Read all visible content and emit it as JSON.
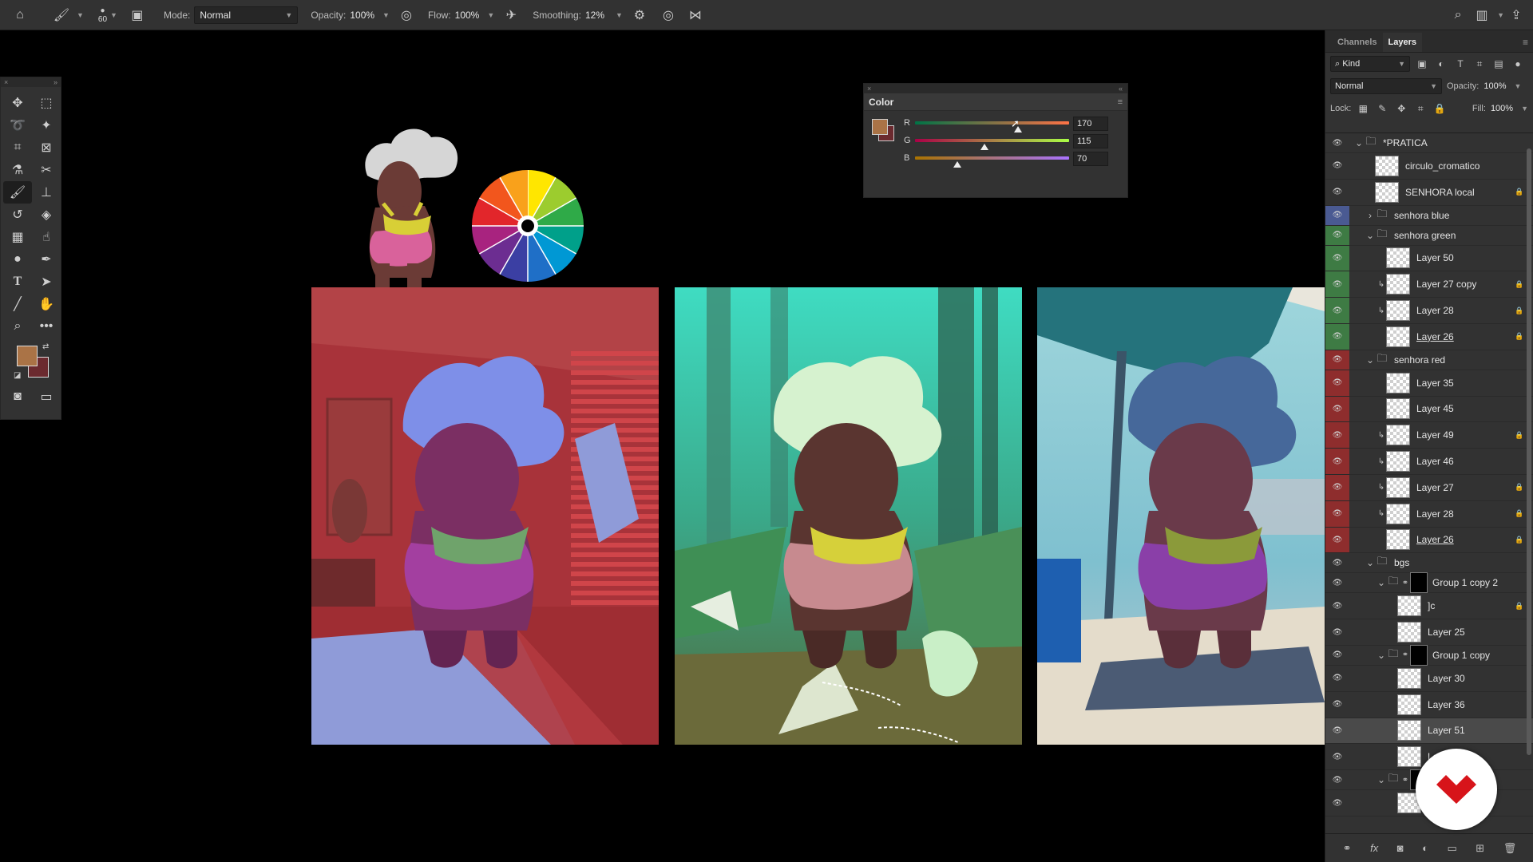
{
  "optbar": {
    "brush_size": "60",
    "mode_label": "Mode:",
    "mode_value": "Normal",
    "opacity_label": "Opacity:",
    "opacity_value": "100%",
    "flow_label": "Flow:",
    "flow_value": "100%",
    "smoothing_label": "Smoothing:",
    "smoothing_value": "12%"
  },
  "colors": {
    "foreground": "#aa7346",
    "background": "#6b2a2f",
    "accent_blue": "#4a5a92",
    "accent_green": "#3e7b44",
    "accent_red": "#8e2d2d"
  },
  "color_panel": {
    "title": "Color",
    "r_label": "R",
    "g_label": "G",
    "b_label": "B",
    "r_value": "170",
    "g_value": "115",
    "b_value": "70",
    "r_level": 0.667,
    "g_level": 0.451,
    "b_level": 0.275
  },
  "layers_panel": {
    "tab_channels": "Channels",
    "tab_layers": "Layers",
    "filter_kind": "Kind",
    "blend_mode": "Normal",
    "opacity_label": "Opacity:",
    "opacity_value": "100%",
    "lock_label": "Lock:",
    "fill_label": "Fill:",
    "fill_value": "100%",
    "layers": [
      {
        "name": "*PRATICA",
        "kind": "group",
        "indent": 0,
        "color": "",
        "open": true
      },
      {
        "name": "circulo_cromatico",
        "kind": "layer",
        "indent": 1,
        "color": "",
        "lock": false,
        "clip": false,
        "ul": false
      },
      {
        "name": "SENHORA local",
        "kind": "layer",
        "indent": 1,
        "color": "",
        "lock": true,
        "clip": false,
        "ul": false
      },
      {
        "name": "senhora blue",
        "kind": "group",
        "indent": 1,
        "color": "blue",
        "open": false
      },
      {
        "name": "senhora green",
        "kind": "group",
        "indent": 1,
        "color": "green",
        "open": true
      },
      {
        "name": "Layer 50",
        "kind": "layer",
        "indent": 2,
        "color": "green",
        "lock": false,
        "clip": false,
        "ul": false
      },
      {
        "name": "Layer 27 copy",
        "kind": "layer",
        "indent": 2,
        "color": "green",
        "lock": true,
        "clip": true,
        "ul": false
      },
      {
        "name": "Layer 28",
        "kind": "layer",
        "indent": 2,
        "color": "green",
        "lock": true,
        "clip": true,
        "ul": false
      },
      {
        "name": "Layer 26",
        "kind": "layer",
        "indent": 2,
        "color": "green",
        "lock": true,
        "clip": false,
        "ul": true
      },
      {
        "name": "senhora red",
        "kind": "group",
        "indent": 1,
        "color": "red",
        "open": true
      },
      {
        "name": "Layer 35",
        "kind": "layer",
        "indent": 2,
        "color": "red",
        "lock": false,
        "clip": false,
        "ul": false
      },
      {
        "name": "Layer 45",
        "kind": "layer",
        "indent": 2,
        "color": "red",
        "lock": false,
        "clip": false,
        "ul": false
      },
      {
        "name": "Layer 49",
        "kind": "layer",
        "indent": 2,
        "color": "red",
        "lock": true,
        "clip": true,
        "ul": false
      },
      {
        "name": "Layer 46",
        "kind": "layer",
        "indent": 2,
        "color": "red",
        "lock": false,
        "clip": true,
        "ul": false
      },
      {
        "name": "Layer 27",
        "kind": "layer",
        "indent": 2,
        "color": "red",
        "lock": true,
        "clip": true,
        "ul": false
      },
      {
        "name": "Layer 28",
        "kind": "layer",
        "indent": 2,
        "color": "red",
        "lock": true,
        "clip": true,
        "ul": false
      },
      {
        "name": "Layer 26",
        "kind": "layer",
        "indent": 2,
        "color": "red",
        "lock": true,
        "clip": false,
        "ul": true
      },
      {
        "name": "bgs",
        "kind": "group",
        "indent": 1,
        "color": "",
        "open": true
      },
      {
        "name": "Group 1 copy 2",
        "kind": "maskgroup",
        "indent": 2,
        "color": "",
        "open": true
      },
      {
        "name": "]c",
        "kind": "layer",
        "indent": 3,
        "color": "",
        "lock": true,
        "clip": false,
        "ul": false
      },
      {
        "name": "Layer 25",
        "kind": "layer",
        "indent": 3,
        "color": "",
        "lock": false,
        "clip": false,
        "ul": false
      },
      {
        "name": "Group 1 copy",
        "kind": "maskgroup",
        "indent": 2,
        "color": "",
        "open": true
      },
      {
        "name": "Layer 30",
        "kind": "layer",
        "indent": 3,
        "color": "",
        "lock": false,
        "clip": false,
        "ul": false
      },
      {
        "name": "Layer 36",
        "kind": "layer",
        "indent": 3,
        "color": "",
        "lock": false,
        "clip": false,
        "ul": false
      },
      {
        "name": "Layer 51",
        "kind": "layer",
        "indent": 3,
        "color": "",
        "lock": false,
        "clip": false,
        "ul": false,
        "selected": true
      },
      {
        "name": "La",
        "kind": "layer",
        "indent": 3,
        "color": "",
        "lock": false,
        "clip": false,
        "ul": false
      },
      {
        "name": "",
        "kind": "maskgroup",
        "indent": 2,
        "color": "",
        "open": true
      },
      {
        "name": "La",
        "kind": "layer",
        "indent": 3,
        "color": "",
        "lock": false,
        "clip": false,
        "ul": false
      }
    ]
  }
}
